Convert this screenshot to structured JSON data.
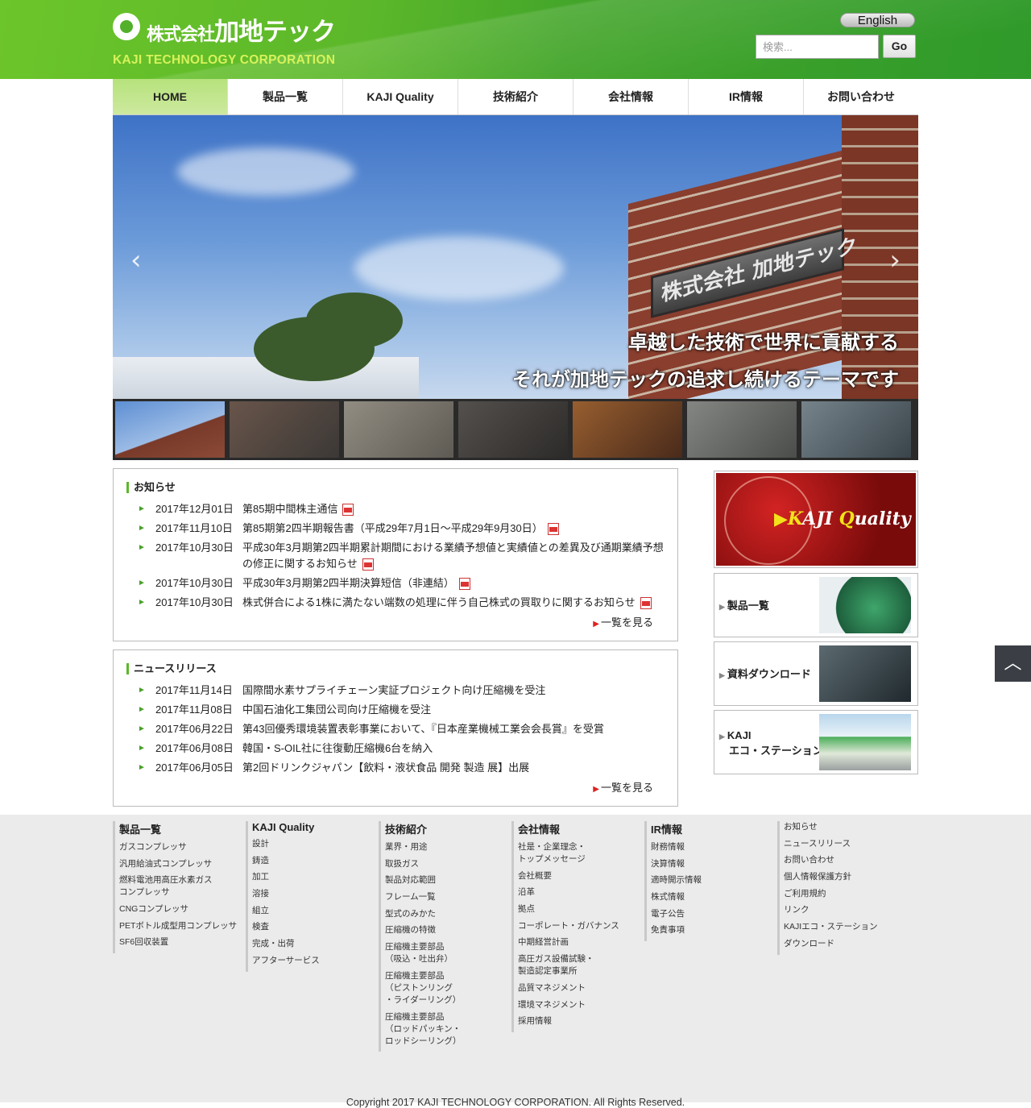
{
  "header": {
    "logo_jp_small": "株式会社",
    "logo_jp": "加地テック",
    "logo_en": "KAJI TECHNOLOGY CORPORATION",
    "english_label": "English",
    "search_placeholder": "検索...",
    "go_label": "Go"
  },
  "nav": [
    {
      "label": "HOME",
      "active": true
    },
    {
      "label": "製品一覧"
    },
    {
      "label": "KAJI Quality"
    },
    {
      "label": "技術紹介"
    },
    {
      "label": "会社情報"
    },
    {
      "label": "IR情報"
    },
    {
      "label": "お問い合わせ"
    }
  ],
  "hero": {
    "plate_text": "株式会社 加地テック",
    "caption_line1": "卓越した技術で世界に貢献する",
    "caption_line2": "それが加地テックの追求し続けるテーマです",
    "prev_icon": "chevron-left-icon",
    "next_icon": "chevron-right-icon",
    "thumbnail_count": 7,
    "active_thumbnail": 1
  },
  "notices": {
    "title": "お知らせ",
    "items": [
      {
        "date": "2017年12月01日",
        "text": "第85期中間株主通信"
      },
      {
        "date": "2017年11月10日",
        "text": "第85期第2四半期報告書（平成29年7月1日～平成29年9月30日）"
      },
      {
        "date": "2017年10月30日",
        "text": "平成30年3月期第2四半期累計期間における業績予想値と実績値との差異及び通期業績予想の修正に関するお知らせ"
      },
      {
        "date": "2017年10月30日",
        "text": "平成30年3月期第2四半期決算短信（非連結）"
      },
      {
        "date": "2017年10月30日",
        "text": "株式併合による1株に満たない端数の処理に伴う自己株式の買取りに関するお知らせ"
      }
    ],
    "more": "一覧を見る"
  },
  "news": {
    "title": "ニュースリリース",
    "items": [
      {
        "date": "2017年11月14日",
        "text": "国際間水素サプライチェーン実証プロジェクト向け圧縮機を受注"
      },
      {
        "date": "2017年11月08日",
        "text": "中国石油化工集団公司向け圧縮機を受注"
      },
      {
        "date": "2017年06月22日",
        "text": "第43回優秀環境装置表彰事業において、『日本産業機械工業会会長賞』を受賞"
      },
      {
        "date": "2017年06月08日",
        "text": "韓国・S-OIL社に往復動圧縮機6台を納入"
      },
      {
        "date": "2017年06月05日",
        "text": "第2回ドリンクジャパン【飲料・液状食品 開発 製造 展】出展"
      }
    ],
    "more": "一覧を見る"
  },
  "side": {
    "kaji_quality": {
      "prefix": "▶",
      "k": "K",
      "aji": "AJI ",
      "q": "Q",
      "uality": "uality"
    },
    "products": "製品一覧",
    "downloads": "資料ダウンロード",
    "eco_line1": "KAJI",
    "eco_line2": "エコ・ステーション"
  },
  "back_to_top_icon": "chevron-up-icon",
  "footer": {
    "columns": [
      {
        "title": "製品一覧",
        "items": [
          "ガスコンプレッサ",
          "汎用給油式コンプレッサ",
          "燃料電池用高圧水素ガス\nコンプレッサ",
          "CNGコンプレッサ",
          "PETボトル成型用コンプレッサ",
          "SF6回収装置"
        ]
      },
      {
        "title": "KAJI Quality",
        "items": [
          "設計",
          "鋳造",
          "加工",
          "溶接",
          "組立",
          "検査",
          "完成・出荷",
          "アフターサービス"
        ]
      },
      {
        "title": "技術紹介",
        "items": [
          "業界・用途",
          "取扱ガス",
          "製品対応範囲",
          "フレーム一覧",
          "型式のみかた",
          "圧縮機の特徴",
          "圧縮機主要部品\n（吸込・吐出弁）",
          "圧縮機主要部品\n（ピストンリング\n・ライダーリング）",
          "圧縮機主要部品\n（ロッドパッキン・\nロッドシーリング）"
        ]
      },
      {
        "title": "会社情報",
        "items": [
          "社是・企業理念・\nトップメッセージ",
          "会社概要",
          "沿革",
          "拠点",
          "コーポレート・ガバナンス",
          "中期経営計画",
          "高圧ガス設備試験・\n製造認定事業所",
          "品質マネジメント",
          "環境マネジメント",
          "採用情報"
        ]
      },
      {
        "title": "IR情報",
        "items": [
          "財務情報",
          "決算情報",
          "適時開示情報",
          "株式情報",
          "電子公告",
          "免責事項"
        ]
      },
      {
        "title": "",
        "items": [
          "お知らせ",
          "ニュースリリース",
          "お問い合わせ",
          "個人情報保護方針",
          "ご利用規約",
          "リンク",
          "KAJIエコ・ステーション",
          "ダウンロード"
        ]
      }
    ],
    "copyright": "Copyright 2017 KAJI TECHNOLOGY CORPORATION. All Rights Reserved."
  }
}
